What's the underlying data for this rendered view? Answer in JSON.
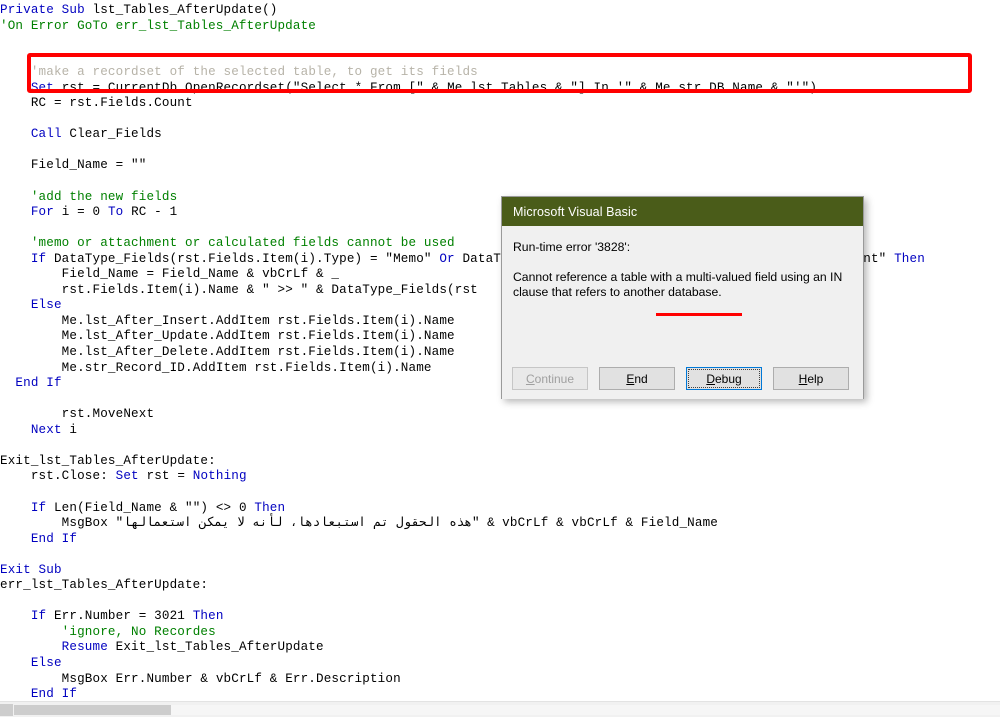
{
  "editor": {
    "name": "vba-code-editor",
    "font_color_keyword": "#0000C0",
    "font_color_comment": "#008000",
    "font_color_text": "#000000",
    "code_lines": [
      {
        "indent": 0,
        "segments": [
          {
            "t": "Private Sub ",
            "c": "kw"
          },
          {
            "t": "lst_Tables_AfterUpdate()",
            "c": "txt"
          }
        ]
      },
      {
        "indent": 0,
        "segments": [
          {
            "t": "'On Error GoTo err_lst_Tables_AfterUpdate",
            "c": "cmt"
          }
        ]
      },
      {
        "indent": 0,
        "segments": []
      },
      {
        "indent": 0,
        "segments": []
      },
      {
        "indent": 4,
        "segments": [
          {
            "t": "'make a recordset of the selected table, to get its fields",
            "c": "cmt"
          }
        ],
        "faded": true
      },
      {
        "indent": 4,
        "segments": [
          {
            "t": "Set ",
            "c": "kw"
          },
          {
            "t": "rst = CurrentDb.OpenRecordset(",
            "c": "txt"
          },
          {
            "t": "\"Select * From [\"",
            "c": "txt"
          },
          {
            "t": " & Me.lst_Tables & ",
            "c": "txt"
          },
          {
            "t": "\"] In '\"",
            "c": "txt"
          },
          {
            "t": " & Me.str_DB_Name & ",
            "c": "txt"
          },
          {
            "t": "\"'\")",
            "c": "txt"
          }
        ]
      },
      {
        "indent": 4,
        "segments": [
          {
            "t": "RC = rst.Fields.Count",
            "c": "txt"
          }
        ],
        "faded": true
      },
      {
        "indent": 0,
        "segments": []
      },
      {
        "indent": 4,
        "segments": [
          {
            "t": "Call ",
            "c": "kw"
          },
          {
            "t": "Clear_Fields",
            "c": "txt"
          }
        ]
      },
      {
        "indent": 0,
        "segments": []
      },
      {
        "indent": 4,
        "segments": [
          {
            "t": "Field_Name = \"\"",
            "c": "txt"
          }
        ]
      },
      {
        "indent": 0,
        "segments": []
      },
      {
        "indent": 4,
        "segments": [
          {
            "t": "'add the new fields",
            "c": "cmt"
          }
        ]
      },
      {
        "indent": 4,
        "segments": [
          {
            "t": "For ",
            "c": "kw"
          },
          {
            "t": "i = 0 ",
            "c": "txt"
          },
          {
            "t": "To ",
            "c": "kw"
          },
          {
            "t": "RC - 1",
            "c": "txt"
          }
        ]
      },
      {
        "indent": 0,
        "segments": []
      },
      {
        "indent": 4,
        "segments": [
          {
            "t": "'memo or attachment or calculated fields cannot be used",
            "c": "cmt"
          }
        ]
      },
      {
        "indent": 4,
        "segments": [
          {
            "t": "If ",
            "c": "kw"
          },
          {
            "t": "DataType_Fields(rst.Fields.Item(i).Type) = \"Memo\" ",
            "c": "txt"
          },
          {
            "t": "Or ",
            "c": "kw"
          },
          {
            "t": "DataType_Fields(rst.Fields.Item(i).Type) = \"Attachment\" ",
            "c": "txt"
          },
          {
            "t": "Then",
            "c": "kw"
          }
        ]
      },
      {
        "indent": 8,
        "segments": [
          {
            "t": "Field_Name = Field_Name & vbCrLf & _",
            "c": "txt"
          }
        ]
      },
      {
        "indent": 8,
        "segments": [
          {
            "t": "rst.Fields.Item(i).Name & \" >> \" & DataType_Fields(rst",
            "c": "txt"
          }
        ]
      },
      {
        "indent": 4,
        "segments": [
          {
            "t": "Else",
            "c": "kw"
          }
        ]
      },
      {
        "indent": 8,
        "segments": [
          {
            "t": "Me.lst_After_Insert.AddItem rst.Fields.Item(i).Name",
            "c": "txt"
          }
        ]
      },
      {
        "indent": 8,
        "segments": [
          {
            "t": "Me.lst_After_Update.AddItem rst.Fields.Item(i).Name",
            "c": "txt"
          }
        ]
      },
      {
        "indent": 8,
        "segments": [
          {
            "t": "Me.lst_After_Delete.AddItem rst.Fields.Item(i).Name",
            "c": "txt"
          }
        ]
      },
      {
        "indent": 8,
        "segments": [
          {
            "t": "Me.str_Record_ID.AddItem rst.Fields.Item(i).Name",
            "c": "txt"
          }
        ]
      },
      {
        "indent": 2,
        "segments": [
          {
            "t": "End If",
            "c": "kw"
          }
        ]
      },
      {
        "indent": 0,
        "segments": []
      },
      {
        "indent": 8,
        "segments": [
          {
            "t": "rst.MoveNext",
            "c": "txt"
          }
        ]
      },
      {
        "indent": 4,
        "segments": [
          {
            "t": "Next ",
            "c": "kw"
          },
          {
            "t": "i",
            "c": "txt"
          }
        ]
      },
      {
        "indent": 0,
        "segments": []
      },
      {
        "indent": 0,
        "segments": [
          {
            "t": "Exit_lst_Tables_AfterUpdate:",
            "c": "txt"
          }
        ]
      },
      {
        "indent": 4,
        "segments": [
          {
            "t": "rst.Close: ",
            "c": "txt"
          },
          {
            "t": "Set ",
            "c": "kw"
          },
          {
            "t": "rst = ",
            "c": "txt"
          },
          {
            "t": "Nothing",
            "c": "kw"
          }
        ]
      },
      {
        "indent": 0,
        "segments": []
      },
      {
        "indent": 4,
        "segments": [
          {
            "t": "If ",
            "c": "kw"
          },
          {
            "t": "Len(Field_Name & \"\") <> 0 ",
            "c": "txt"
          },
          {
            "t": "Then",
            "c": "kw"
          }
        ]
      },
      {
        "indent": 8,
        "segments": [
          {
            "t": "MsgBox \"هذه الحقول تم استبعادها، لأنه لا يمكن استعمالها\" & vbCrLf & vbCrLf & Field_Name",
            "c": "txt"
          }
        ]
      },
      {
        "indent": 4,
        "segments": [
          {
            "t": "End If",
            "c": "kw"
          }
        ]
      },
      {
        "indent": 0,
        "segments": []
      },
      {
        "indent": 0,
        "segments": [
          {
            "t": "Exit Sub",
            "c": "kw"
          }
        ]
      },
      {
        "indent": 0,
        "segments": [
          {
            "t": "err_lst_Tables_AfterUpdate:",
            "c": "txt"
          }
        ]
      },
      {
        "indent": 0,
        "segments": []
      },
      {
        "indent": 4,
        "segments": [
          {
            "t": "If ",
            "c": "kw"
          },
          {
            "t": "Err.Number = 3021 ",
            "c": "txt"
          },
          {
            "t": "Then",
            "c": "kw"
          }
        ]
      },
      {
        "indent": 8,
        "segments": [
          {
            "t": "'ignore, No Recordes",
            "c": "cmt"
          }
        ]
      },
      {
        "indent": 8,
        "segments": [
          {
            "t": "Resume ",
            "c": "kw"
          },
          {
            "t": "Exit_lst_Tables_AfterUpdate",
            "c": "txt"
          }
        ]
      },
      {
        "indent": 4,
        "segments": [
          {
            "t": "Else",
            "c": "kw"
          }
        ]
      },
      {
        "indent": 8,
        "segments": [
          {
            "t": "MsgBox Err.Number & vbCrLf & Err.Description",
            "c": "txt"
          }
        ]
      },
      {
        "indent": 4,
        "segments": [
          {
            "t": "End If",
            "c": "kw"
          }
        ]
      }
    ]
  },
  "annotations": {
    "code_highlight_box": {
      "name": "red-annotation-box",
      "color": "#ff0000",
      "targets_line": "Set rst = CurrentDb.OpenRecordset(\"Select * From [\" & Me.lst_Tables & \"] In '\" & Me.str_DB_Name & \"'\")"
    },
    "message_underline": {
      "name": "red-underline-annotation",
      "color": "#ff0000",
      "underlines_text": "multi-valued field"
    }
  },
  "dialog": {
    "name": "microsoft-visual-basic-error-dialog",
    "title": "Microsoft Visual Basic",
    "titlebar_color": "#4a5c19",
    "error_code_line": "Run-time error '3828':",
    "error_message": "Cannot reference a table with a multi-valued field using an IN clause that refers to another database.",
    "buttons": [
      {
        "label": "Continue",
        "accesskey": "C",
        "state": "disabled",
        "focused": false
      },
      {
        "label": "End",
        "accesskey": "E",
        "state": "enabled",
        "focused": false
      },
      {
        "label": "Debug",
        "accesskey": "D",
        "state": "enabled",
        "focused": true
      },
      {
        "label": "Help",
        "accesskey": "H",
        "state": "enabled",
        "focused": false
      }
    ]
  },
  "scrollbar": {
    "name": "horizontal-scrollbar",
    "orientation": "horizontal",
    "thumb_color": "#cdcdcd",
    "track_color": "#f1f1f1",
    "position_percent": 0
  }
}
